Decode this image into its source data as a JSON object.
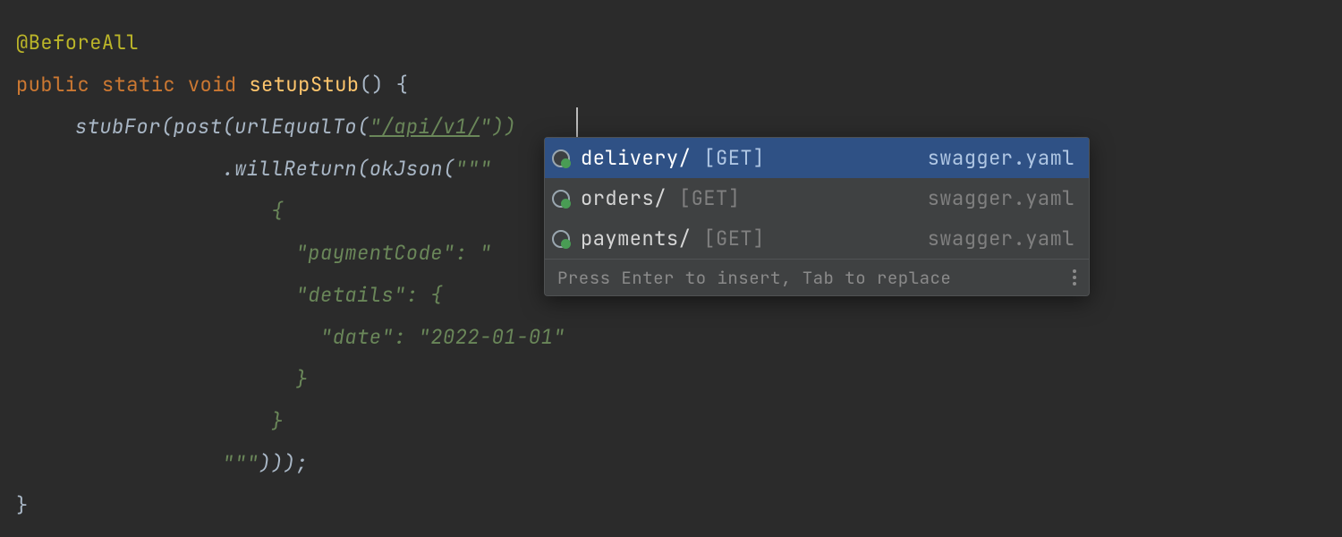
{
  "code": {
    "annotation": "@BeforeAll",
    "kw_public": "public",
    "kw_static": "static",
    "kw_void": "void",
    "method_name": "setupStub",
    "parens_open": "() {",
    "stub_line_a": "stubFor",
    "stub_line_b": "(",
    "stub_line_c": "post",
    "stub_line_d": "(",
    "stub_line_e": "urlEqualTo",
    "stub_line_f": "(",
    "url_literal": "\"/api/v1/",
    "close_parens": "\"))",
    "will_a": ".",
    "will_b": "willReturn",
    "will_c": "(",
    "will_d": "okJson",
    "will_e": "(",
    "triple_quote": "\"\"\"",
    "json1": "{",
    "json2": "  \"paymentCode\": \"",
    "json3": "  \"details\": {",
    "json4": "    \"date\": \"2022-01-01\"",
    "json5": "  }",
    "json6": "}",
    "close_triple": "\"\"\"",
    "close_call": ")));",
    "close_method": "}"
  },
  "popup": {
    "items": [
      {
        "name": "delivery/",
        "meta": "[GET]",
        "src": "swagger.yaml"
      },
      {
        "name": "orders/",
        "meta": "[GET]",
        "src": "swagger.yaml"
      },
      {
        "name": "payments/",
        "meta": "[GET]",
        "src": "swagger.yaml"
      }
    ],
    "hint": "Press Enter to insert, Tab to replace"
  }
}
